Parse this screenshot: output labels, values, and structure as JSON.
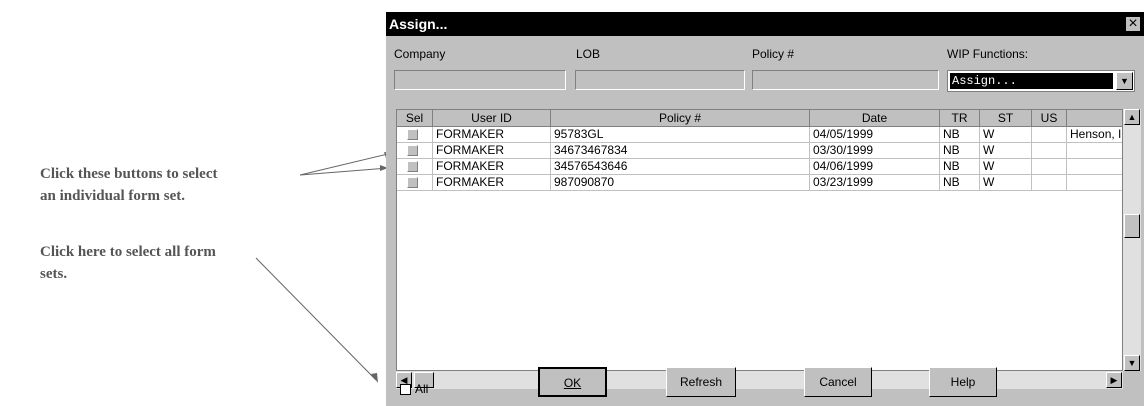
{
  "callouts": {
    "line1": "Click these buttons to select",
    "line2": "an individual form set.",
    "line3": "Click here to select all form",
    "line4": "sets."
  },
  "dialog": {
    "title": "Assign...",
    "close": "×",
    "labels": {
      "company": "Company",
      "lob": "LOB",
      "policy": "Policy #",
      "wip": "WIP Functions:"
    },
    "wip_selected": "Assign...",
    "columns": [
      "Sel",
      "User ID",
      "Policy #",
      "Date",
      "TR",
      "ST",
      "US",
      ""
    ],
    "rows": [
      {
        "user": "FORMAKER",
        "policy": "95783GL",
        "date": "04/05/1999",
        "tr": "NB",
        "st": "W",
        "us": "",
        "extra": "Henson, I"
      },
      {
        "user": "FORMAKER",
        "policy": "34673467834",
        "date": "03/30/1999",
        "tr": "NB",
        "st": "W",
        "us": "",
        "extra": ""
      },
      {
        "user": "FORMAKER",
        "policy": "34576543646",
        "date": "04/06/1999",
        "tr": "NB",
        "st": "W",
        "us": "",
        "extra": ""
      },
      {
        "user": "FORMAKER",
        "policy": "987090870",
        "date": "03/23/1999",
        "tr": "NB",
        "st": "W",
        "us": "",
        "extra": ""
      }
    ],
    "all_label": "All",
    "buttons": {
      "ok": "OK",
      "refresh": "Refresh",
      "cancel": "Cancel",
      "help": "Help"
    }
  }
}
